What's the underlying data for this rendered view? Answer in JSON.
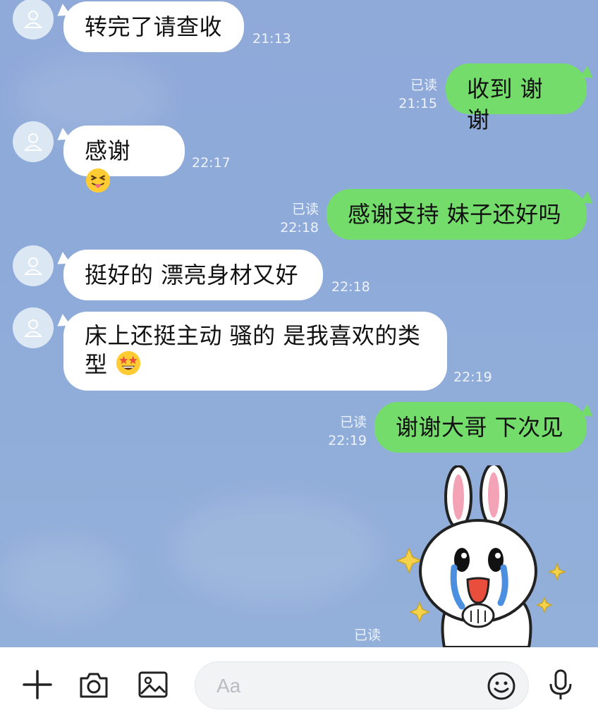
{
  "messages": [
    {
      "side": "in",
      "text": "转完了请查收",
      "time": "21:13"
    },
    {
      "side": "out",
      "text": "收到 谢谢",
      "read": "已读",
      "time": "21:15"
    },
    {
      "side": "in",
      "text": "感谢",
      "emoji": "squinting-tongue-emoji",
      "time": "22:17"
    },
    {
      "side": "out",
      "text": "感谢支持 妹子还好吗",
      "read": "已读",
      "time": "22:18"
    },
    {
      "side": "in",
      "text": "挺好的 漂亮身材又好",
      "time": "22:18"
    },
    {
      "side": "in",
      "line1": "床上还挺主动 骚的 是我喜欢的类",
      "line2": "型",
      "emoji": "star-struck-emoji",
      "time": "22:19"
    },
    {
      "side": "out",
      "text": "谢谢大哥 下次见",
      "read": "已读",
      "time": "22:19"
    },
    {
      "side": "out",
      "sticker": "crying-bunny-sticker",
      "read": "已读"
    }
  ],
  "input": {
    "placeholder": "Aa"
  },
  "toolbar": {
    "icons": [
      "plus-icon",
      "camera-icon",
      "image-icon",
      "emoji-icon",
      "microphone-icon"
    ]
  },
  "colors": {
    "background": "#8ea9d9",
    "incoming_bubble": "#ffffff",
    "outgoing_bubble": "#74dc6a"
  }
}
